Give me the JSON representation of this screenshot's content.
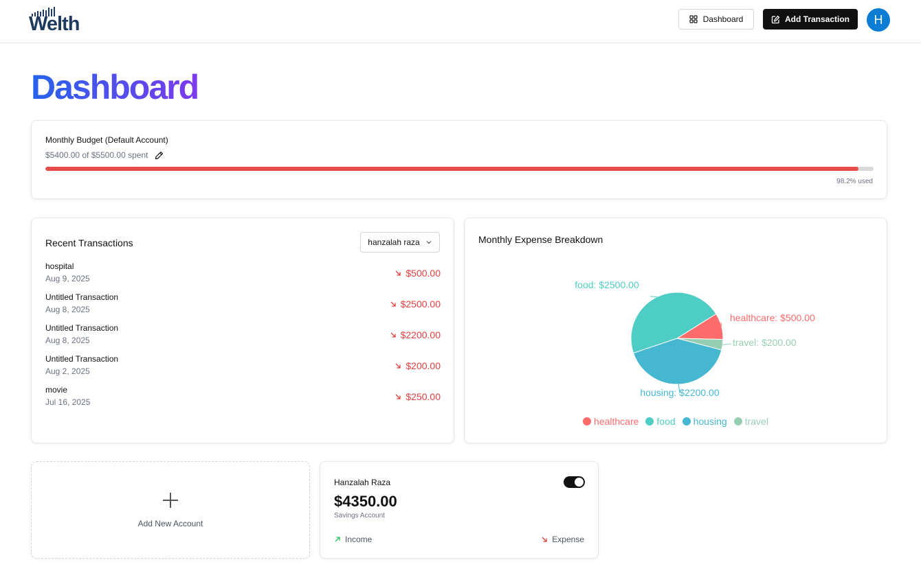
{
  "header": {
    "logo_text": "Welth",
    "dashboard_label": "Dashboard",
    "add_transaction_label": "Add Transaction",
    "avatar_initial": "H",
    "avatar_color": "#0b7dd4"
  },
  "page": {
    "title": "Dashboard"
  },
  "budget": {
    "title": "Monthly Budget (Default Account)",
    "spent_text": "$5400.00 of $5500.00 spent",
    "used_text": "98.2% used",
    "used_fraction": 0.982,
    "bar_color": "#e74c4c"
  },
  "transactions": {
    "title": "Recent Transactions",
    "account_selector": "hanzalah raza",
    "items": [
      {
        "name": "hospital",
        "date": "Aug 9, 2025",
        "amount": "$500.00",
        "type": "expense"
      },
      {
        "name": "Untitled Transaction",
        "date": "Aug 8, 2025",
        "amount": "$2500.00",
        "type": "expense"
      },
      {
        "name": "Untitled Transaction",
        "date": "Aug 8, 2025",
        "amount": "$2200.00",
        "type": "expense"
      },
      {
        "name": "Untitled Transaction",
        "date": "Aug 2, 2025",
        "amount": "$200.00",
        "type": "expense"
      },
      {
        "name": "movie",
        "date": "Jul 16, 2025",
        "amount": "$250.00",
        "type": "expense"
      }
    ]
  },
  "expense_chart": {
    "title": "Monthly Expense Breakdown"
  },
  "chart_data": {
    "type": "pie",
    "title": "Monthly Expense Breakdown",
    "legend_position": "bottom",
    "slices": [
      {
        "name": "healthcare",
        "value": 500,
        "label": "healthcare: $500.00",
        "color": "#ff6b6b"
      },
      {
        "name": "food",
        "value": 2500,
        "label": "food: $2500.00",
        "color": "#4ecdc4"
      },
      {
        "name": "housing",
        "value": 2200,
        "label": "housing: $2200.00",
        "color": "#45b7d1"
      },
      {
        "name": "travel",
        "value": 200,
        "label": "travel: $200.00",
        "color": "#96ceb4"
      }
    ]
  },
  "accounts": {
    "add_label": "Add New Account",
    "cards": [
      {
        "name": "Hanzalah Raza",
        "balance": "$4350.00",
        "type": "Savings Account",
        "default": true,
        "income_label": "Income",
        "expense_label": "Expense"
      }
    ]
  }
}
